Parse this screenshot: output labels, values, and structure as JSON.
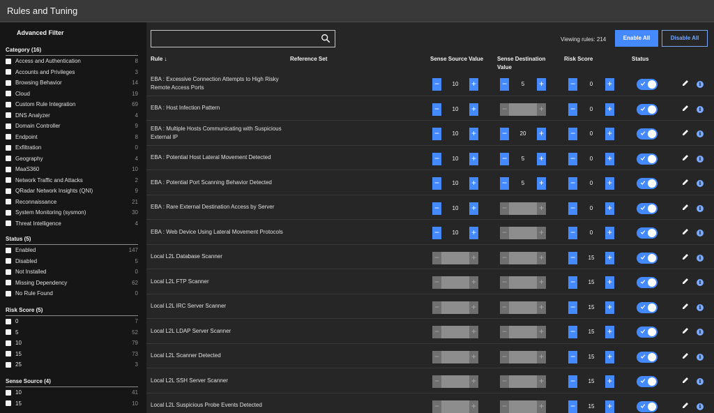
{
  "window": {
    "title": "Rules and Tuning"
  },
  "sidebar": {
    "heading": "Advanced Filter",
    "sections": [
      {
        "title": "Category  (16)",
        "items": [
          {
            "label": "Access and Authentication",
            "count": "8"
          },
          {
            "label": "Accounts and Privileges",
            "count": "3"
          },
          {
            "label": "Browsing Behavior",
            "count": "14"
          },
          {
            "label": "Cloud",
            "count": "19"
          },
          {
            "label": "Custom Rule Integration",
            "count": "69"
          },
          {
            "label": "DNS Analyzer",
            "count": "4"
          },
          {
            "label": "Domain Controller",
            "count": "9"
          },
          {
            "label": "Endpoint",
            "count": "8"
          },
          {
            "label": "Exfiltration",
            "count": "0"
          },
          {
            "label": "Geography",
            "count": "4"
          },
          {
            "label": "MaaS360",
            "count": "10"
          },
          {
            "label": "Network Traffic and Attacks",
            "count": "2"
          },
          {
            "label": "QRadar Network Insights (QNI)",
            "count": "9"
          },
          {
            "label": "Reconnaissance",
            "count": "21"
          },
          {
            "label": "System Monitoring (sysmon)",
            "count": "30"
          },
          {
            "label": "Threat Intelligence",
            "count": "4"
          }
        ]
      },
      {
        "title": "Status  (5)",
        "items": [
          {
            "label": "Enabled",
            "count": "147"
          },
          {
            "label": "Disabled",
            "count": "5"
          },
          {
            "label": "Not Installed",
            "count": "0"
          },
          {
            "label": "Missing Dependency",
            "count": "62"
          },
          {
            "label": "No Rule Found",
            "count": "0"
          }
        ]
      },
      {
        "title": "Risk Score  (5)",
        "items": [
          {
            "label": "0",
            "count": "7"
          },
          {
            "label": "5",
            "count": "52"
          },
          {
            "label": "10",
            "count": "79"
          },
          {
            "label": "15",
            "count": "73"
          },
          {
            "label": "25",
            "count": "3"
          }
        ]
      },
      {
        "title": "Sense Source  (4)",
        "items": [
          {
            "label": "10",
            "count": "41"
          },
          {
            "label": "15",
            "count": "10"
          }
        ]
      }
    ]
  },
  "toolbar": {
    "search_placeholder": "",
    "viewing": "Viewing rules: 214",
    "enable_all": "Enable All",
    "disable_all": "Disable All"
  },
  "table": {
    "headers": {
      "rule": "Rule ↓",
      "reference_set": "Reference Set",
      "sense_source": "Sense Source Value",
      "sense_destination": "Sense Destination Value",
      "risk_score": "Risk Score",
      "status": "Status"
    },
    "rows": [
      {
        "rule": "EBA : Excessive Connection Attempts to High Risky Remote Access Ports",
        "source": "10",
        "source_enabled": true,
        "dest": "5",
        "dest_enabled": true,
        "risk": "0",
        "status": "enabled"
      },
      {
        "rule": "EBA : Host Infection Pattern",
        "source": "10",
        "source_enabled": true,
        "dest": "",
        "dest_enabled": false,
        "risk": "0",
        "status": "enabled"
      },
      {
        "rule": "EBA : Multiple Hosts Communicating with Suspicious External IP",
        "source": "10",
        "source_enabled": true,
        "dest": "20",
        "dest_enabled": true,
        "risk": "0",
        "status": "enabled"
      },
      {
        "rule": "EBA : Potential Host Lateral Movement Detected",
        "source": "10",
        "source_enabled": true,
        "dest": "5",
        "dest_enabled": true,
        "risk": "0",
        "status": "enabled"
      },
      {
        "rule": "EBA : Potential Port Scanning Behavior Detected",
        "source": "10",
        "source_enabled": true,
        "dest": "5",
        "dest_enabled": true,
        "risk": "0",
        "status": "enabled"
      },
      {
        "rule": "EBA : Rare External Destination Access by Server",
        "source": "10",
        "source_enabled": true,
        "dest": "",
        "dest_enabled": false,
        "risk": "0",
        "status": "enabled"
      },
      {
        "rule": "EBA : Web Device Using Lateral Movement Protocols",
        "source": "10",
        "source_enabled": true,
        "dest": "",
        "dest_enabled": false,
        "risk": "0",
        "status": "enabled"
      },
      {
        "rule": "Local L2L Database Scanner",
        "source": "",
        "source_enabled": false,
        "dest": "",
        "dest_enabled": false,
        "risk": "15",
        "status": "enabled"
      },
      {
        "rule": "Local L2L FTP Scanner",
        "source": "",
        "source_enabled": false,
        "dest": "",
        "dest_enabled": false,
        "risk": "15",
        "status": "enabled"
      },
      {
        "rule": "Local L2L IRC Server Scanner",
        "source": "",
        "source_enabled": false,
        "dest": "",
        "dest_enabled": false,
        "risk": "15",
        "status": "enabled"
      },
      {
        "rule": "Local L2L LDAP Server Scanner",
        "source": "",
        "source_enabled": false,
        "dest": "",
        "dest_enabled": false,
        "risk": "15",
        "status": "enabled"
      },
      {
        "rule": "Local L2L Scanner Detected",
        "source": "",
        "source_enabled": false,
        "dest": "",
        "dest_enabled": false,
        "risk": "15",
        "status": "enabled"
      },
      {
        "rule": "Local L2L SSH Server Scanner",
        "source": "",
        "source_enabled": false,
        "dest": "",
        "dest_enabled": false,
        "risk": "15",
        "status": "enabled"
      },
      {
        "rule": "Local L2L Suspicious Probe Events Detected",
        "source": "",
        "source_enabled": false,
        "dest": "",
        "dest_enabled": false,
        "risk": "15",
        "status": "enabled"
      }
    ]
  },
  "icons": {
    "search": "search-icon",
    "edit": "pencil-icon",
    "info": "info-icon",
    "info_glyph": "i",
    "minus_glyph": "−",
    "plus_glyph": "+"
  },
  "colors": {
    "accent": "#4589ff",
    "link": "#78a9ff",
    "background": "#161616",
    "panel": "#262626"
  }
}
